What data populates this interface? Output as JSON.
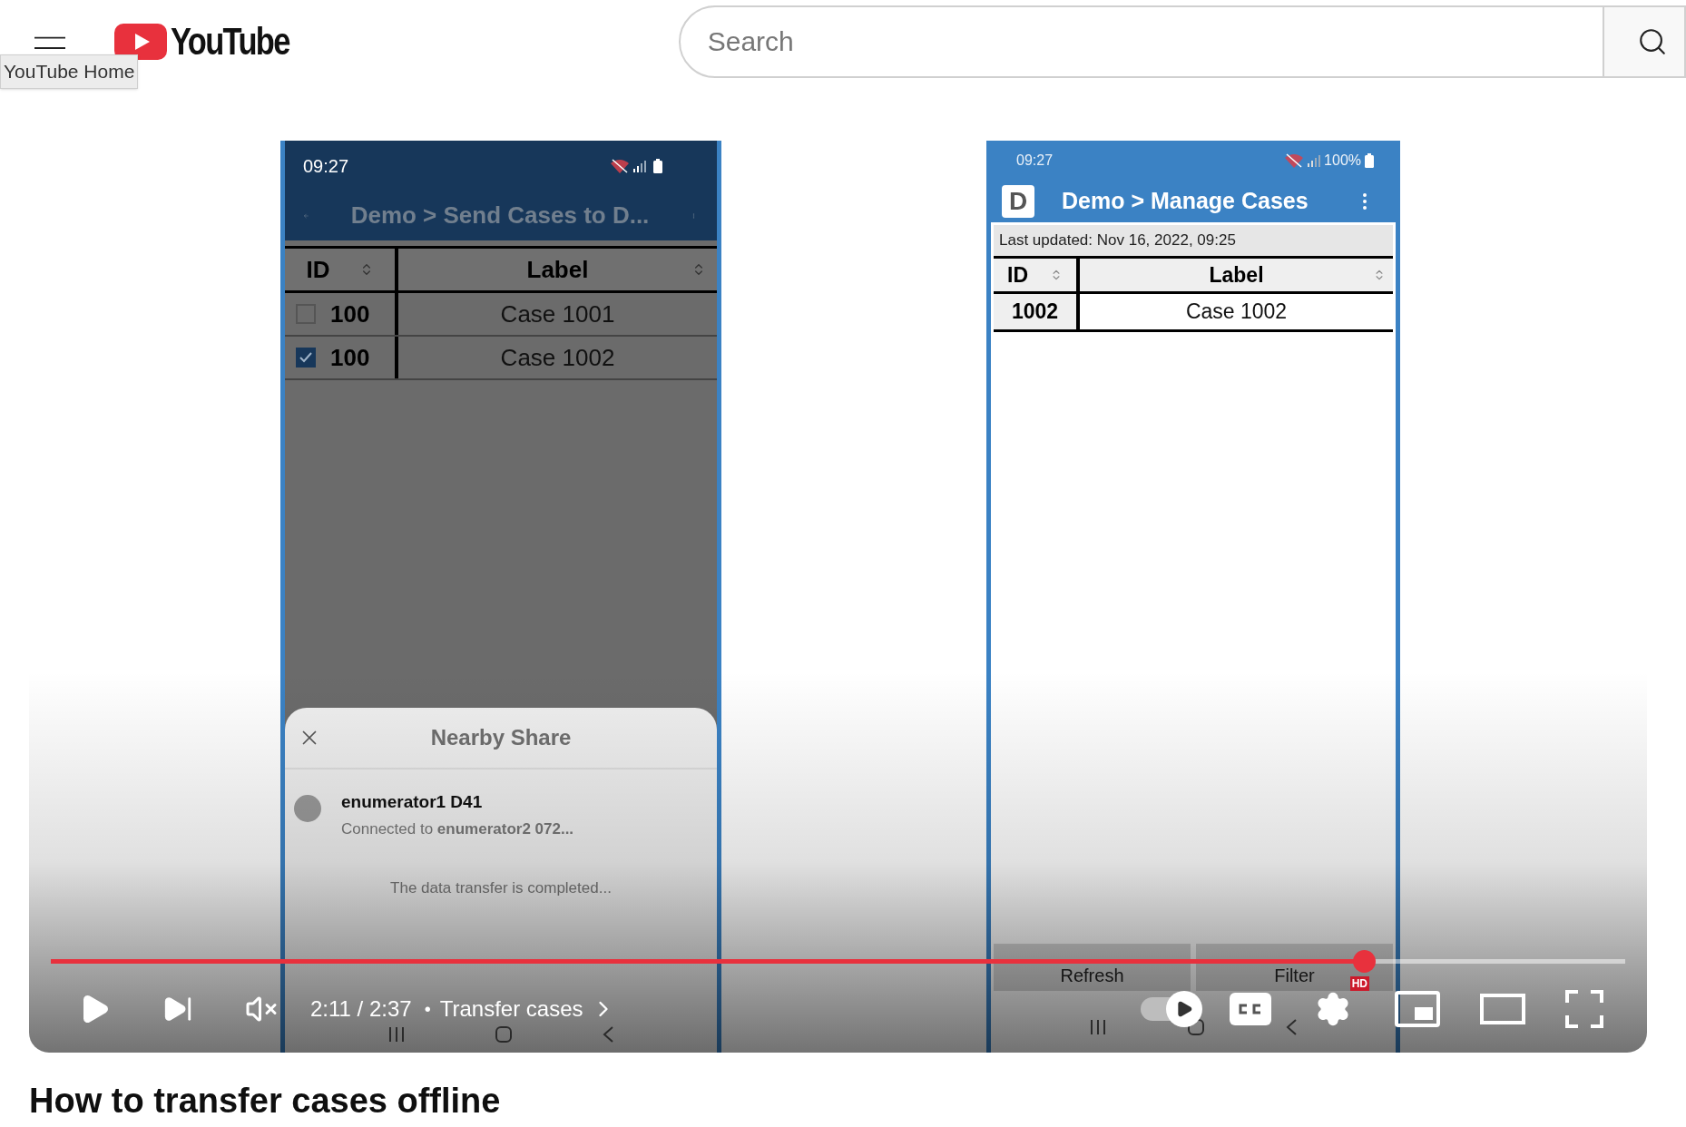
{
  "header": {
    "logo_text": "YouTube",
    "tooltip": "YouTube Home",
    "search": {
      "placeholder": "Search"
    }
  },
  "video": {
    "phones": [
      {
        "kind": "share_dialog",
        "time": "09:27",
        "title": "Demo > Send Cases to D...",
        "columns": [
          "ID",
          "Label"
        ],
        "rows": [
          {
            "id": "100",
            "label": "Case 1001",
            "checked": false
          },
          {
            "id": "100",
            "label": "Case 1002",
            "checked": true
          }
        ],
        "sheet": {
          "title": "Nearby Share",
          "device": "enumerator1 D41",
          "status": "Connected to **enumerator2 072...**",
          "message": "The data transfer is completed..."
        }
      },
      {
        "kind": "case_list",
        "time": "09:27",
        "battery": "100%",
        "badge": "D",
        "title": "Demo > Manage Cases",
        "last_updated": "Last updated: Nov 16, 2022, 09:25",
        "columns": [
          "ID",
          "Label"
        ],
        "rows": [
          {
            "id": "1002",
            "label": "Case 1002"
          }
        ],
        "buttons": [
          "Refresh",
          "Filter"
        ]
      }
    ],
    "player": {
      "progress": {
        "level": 0.834
      },
      "time": "2:11 / 2:37",
      "separator": "•",
      "chapter": "Transfer cases",
      "muted": true,
      "autoplay": true,
      "quality_badge": "HD"
    }
  },
  "title": "How to transfer cases offline"
}
